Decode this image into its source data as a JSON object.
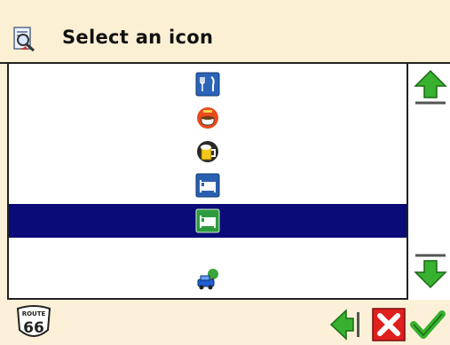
{
  "header": {
    "title": "Select an icon",
    "icon": "magnifier-document-icon"
  },
  "list": {
    "items": [
      {
        "icon": "restaurant-icon"
      },
      {
        "icon": "coffee-icon"
      },
      {
        "icon": "beer-icon"
      },
      {
        "icon": "hotel-bed-icon"
      },
      {
        "icon": "hotel-bed-green-icon",
        "selected": true
      },
      {
        "icon": "car-tree-icon"
      }
    ],
    "selected_index": 4
  },
  "scroll": {
    "up_icon": "arrow-up-icon",
    "down_icon": "arrow-down-icon"
  },
  "footer": {
    "route_sign": {
      "top": "ROUTE",
      "number": "66"
    },
    "buttons": [
      {
        "name": "back-button",
        "icon": "arrow-left-icon"
      },
      {
        "name": "cancel-button",
        "icon": "close-x-icon"
      },
      {
        "name": "confirm-button",
        "icon": "checkmark-icon"
      }
    ]
  },
  "colors": {
    "header_bg": "#fbf0d4",
    "selected_bg": "#0a0a78",
    "arrow_green": "#37b12f",
    "cancel_red": "#e0201e"
  }
}
